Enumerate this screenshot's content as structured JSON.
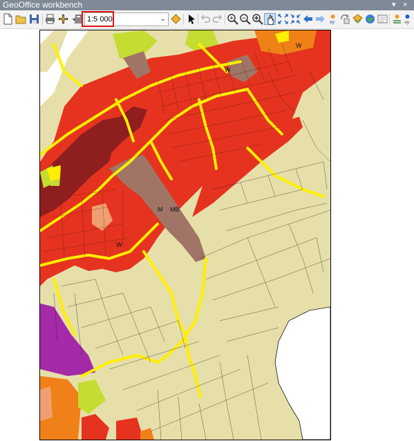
{
  "window": {
    "title": "GeoOffice workbench",
    "pin_glyph": "▾",
    "close_glyph": "×"
  },
  "toolbar": {
    "scale_value": "1:5 000",
    "scale_dropdown_glyph": "⌄",
    "icons": [
      "new-document-icon",
      "open-folder-icon",
      "save-icon",
      "print-icon",
      "add-data-icon",
      "add-data-dropdown-icon",
      "catalog-icon",
      "scale-set-icon",
      "select-arrow-icon",
      "undo-icon",
      "redo-icon",
      "zoom-in-icon",
      "zoom-out-icon",
      "zoom-rectangle-icon",
      "pan-hand-icon",
      "full-extent-icon",
      "fixed-zoom-icon",
      "back-extent-icon",
      "forward-extent-icon",
      "xy-coordinate-icon",
      "rotate-icon",
      "layer-icon",
      "globe-icon",
      "measure-icon",
      "identify-icon",
      "goto-xy-icon"
    ]
  },
  "map": {
    "zone_labels": {
      "w1": "W",
      "w2": "W",
      "w3": "W",
      "mb1": "M",
      "mb2": "MB"
    },
    "colors": {
      "residential": "#e5331f",
      "dense": "#8f1e1e",
      "mixed": "#a07565",
      "orange": "#f08018",
      "green": "#c5dc32",
      "purple": "#a52aa8",
      "roads": "#ffef00",
      "base": "#e7dfa9"
    }
  }
}
